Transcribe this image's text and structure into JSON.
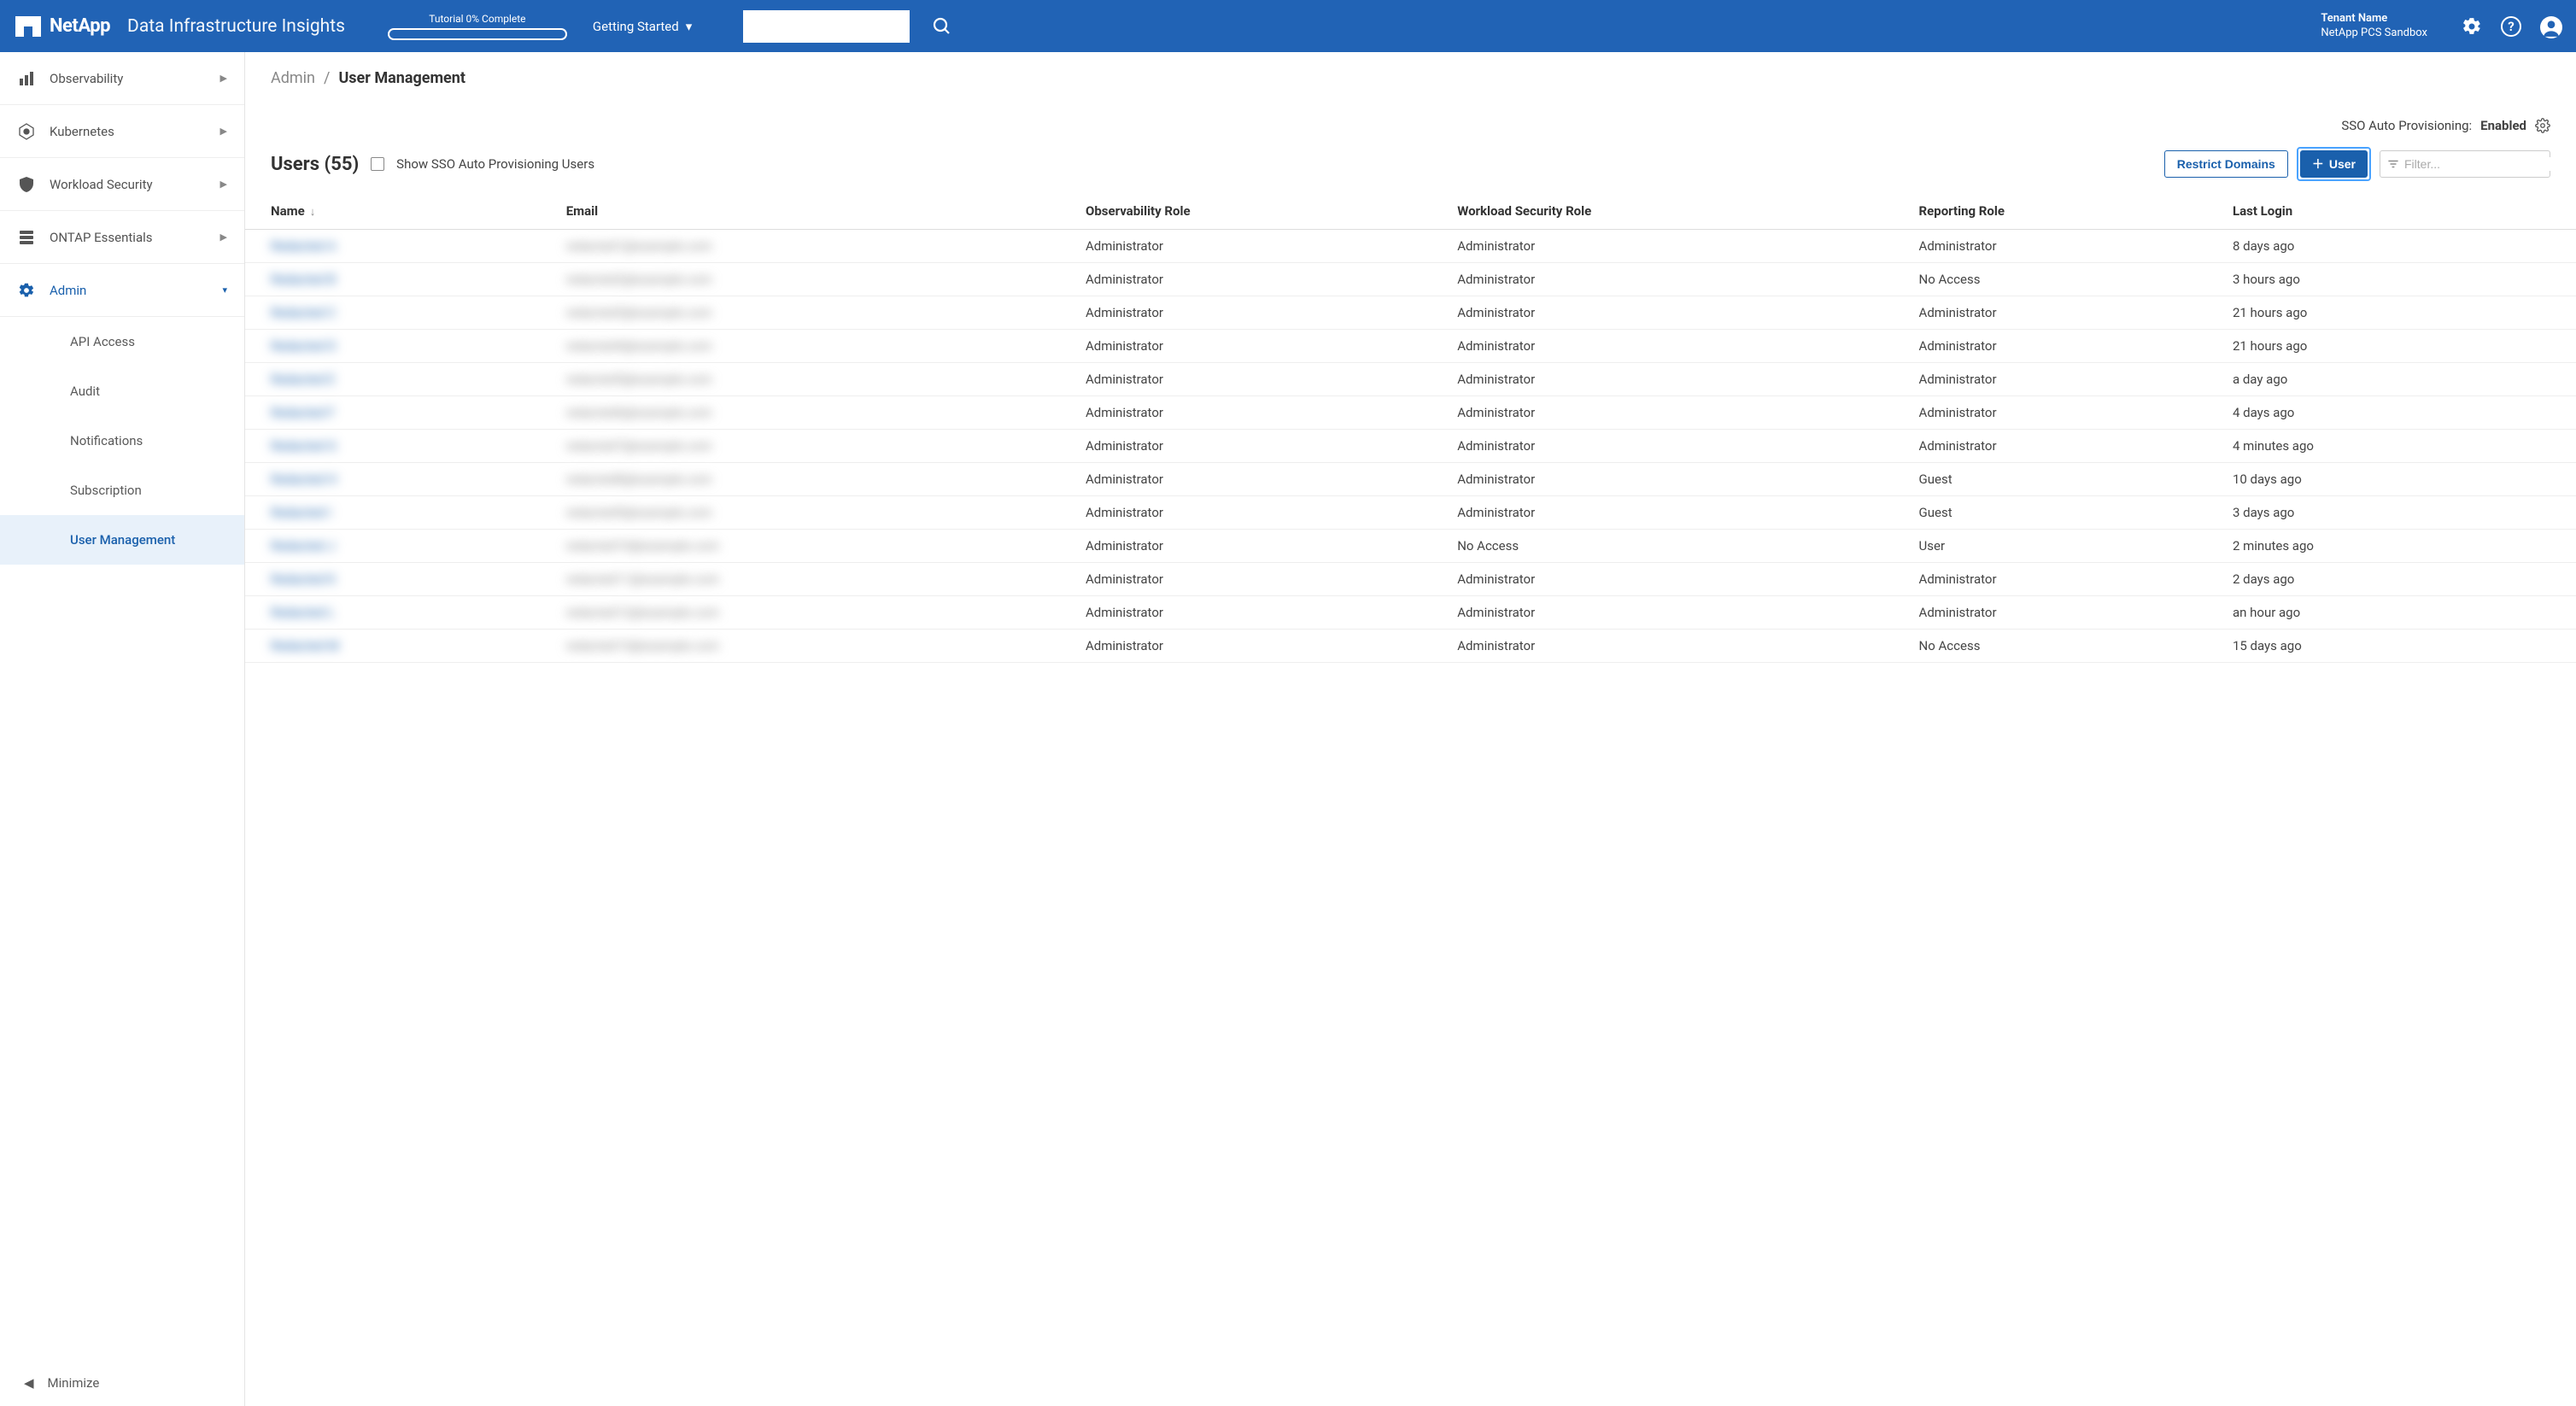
{
  "header": {
    "brand": "NetApp",
    "product": "Data Infrastructure Insights",
    "tutorial_label": "Tutorial 0% Complete",
    "getting_started": "Getting Started",
    "tenant_label": "Tenant Name",
    "tenant_value": "NetApp PCS Sandbox"
  },
  "sidebar": {
    "items": [
      {
        "label": "Observability",
        "icon": "bars"
      },
      {
        "label": "Kubernetes",
        "icon": "kube"
      },
      {
        "label": "Workload Security",
        "icon": "shield"
      },
      {
        "label": "ONTAP Essentials",
        "icon": "stack"
      },
      {
        "label": "Admin",
        "icon": "gear"
      }
    ],
    "admin_sub": [
      {
        "label": "API Access"
      },
      {
        "label": "Audit"
      },
      {
        "label": "Notifications"
      },
      {
        "label": "Subscription"
      },
      {
        "label": "User Management"
      }
    ],
    "minimize": "Minimize"
  },
  "breadcrumb": {
    "parent": "Admin",
    "current": "User Management"
  },
  "sso": {
    "label": "SSO Auto Provisioning: ",
    "value": "Enabled"
  },
  "toolbar": {
    "title": "Users (55)",
    "checkbox_label": "Show SSO Auto Provisioning Users",
    "restrict_label": "Restrict Domains",
    "add_user_label": "User",
    "filter_placeholder": "Filter..."
  },
  "table": {
    "columns": [
      "Name",
      "Email",
      "Observability Role",
      "Workload Security Role",
      "Reporting Role",
      "Last Login"
    ],
    "rows": [
      {
        "name": "Redacted A",
        "email": "redacted1@example.com",
        "obs": "Administrator",
        "ws": "Administrator",
        "rep": "Administrator",
        "last": "8 days ago"
      },
      {
        "name": "Redacted B",
        "email": "redacted2@example.com",
        "obs": "Administrator",
        "ws": "Administrator",
        "rep": "No Access",
        "last": "3 hours ago"
      },
      {
        "name": "Redacted C",
        "email": "redacted3@example.com",
        "obs": "Administrator",
        "ws": "Administrator",
        "rep": "Administrator",
        "last": "21 hours ago"
      },
      {
        "name": "Redacted D",
        "email": "redacted4@example.com",
        "obs": "Administrator",
        "ws": "Administrator",
        "rep": "Administrator",
        "last": "21 hours ago"
      },
      {
        "name": "Redacted E",
        "email": "redacted5@example.com",
        "obs": "Administrator",
        "ws": "Administrator",
        "rep": "Administrator",
        "last": "a day ago"
      },
      {
        "name": "Redacted F",
        "email": "redacted6@example.com",
        "obs": "Administrator",
        "ws": "Administrator",
        "rep": "Administrator",
        "last": "4 days ago"
      },
      {
        "name": "Redacted G",
        "email": "redacted7@example.com",
        "obs": "Administrator",
        "ws": "Administrator",
        "rep": "Administrator",
        "last": "4 minutes ago"
      },
      {
        "name": "Redacted H",
        "email": "redacted8@example.com",
        "obs": "Administrator",
        "ws": "Administrator",
        "rep": "Guest",
        "last": "10 days ago"
      },
      {
        "name": "Redacted I",
        "email": "redacted9@example.com",
        "obs": "Administrator",
        "ws": "Administrator",
        "rep": "Guest",
        "last": "3 days ago"
      },
      {
        "name": "Redacted J",
        "email": "redacted10@example.com",
        "obs": "Administrator",
        "ws": "No Access",
        "rep": "User",
        "last": "2 minutes ago"
      },
      {
        "name": "Redacted K",
        "email": "redacted11@example.com",
        "obs": "Administrator",
        "ws": "Administrator",
        "rep": "Administrator",
        "last": "2 days ago"
      },
      {
        "name": "Redacted L",
        "email": "redacted12@example.com",
        "obs": "Administrator",
        "ws": "Administrator",
        "rep": "Administrator",
        "last": "an hour ago"
      },
      {
        "name": "Redacted M",
        "email": "redacted13@example.com",
        "obs": "Administrator",
        "ws": "Administrator",
        "rep": "No Access",
        "last": "15 days ago"
      }
    ]
  }
}
